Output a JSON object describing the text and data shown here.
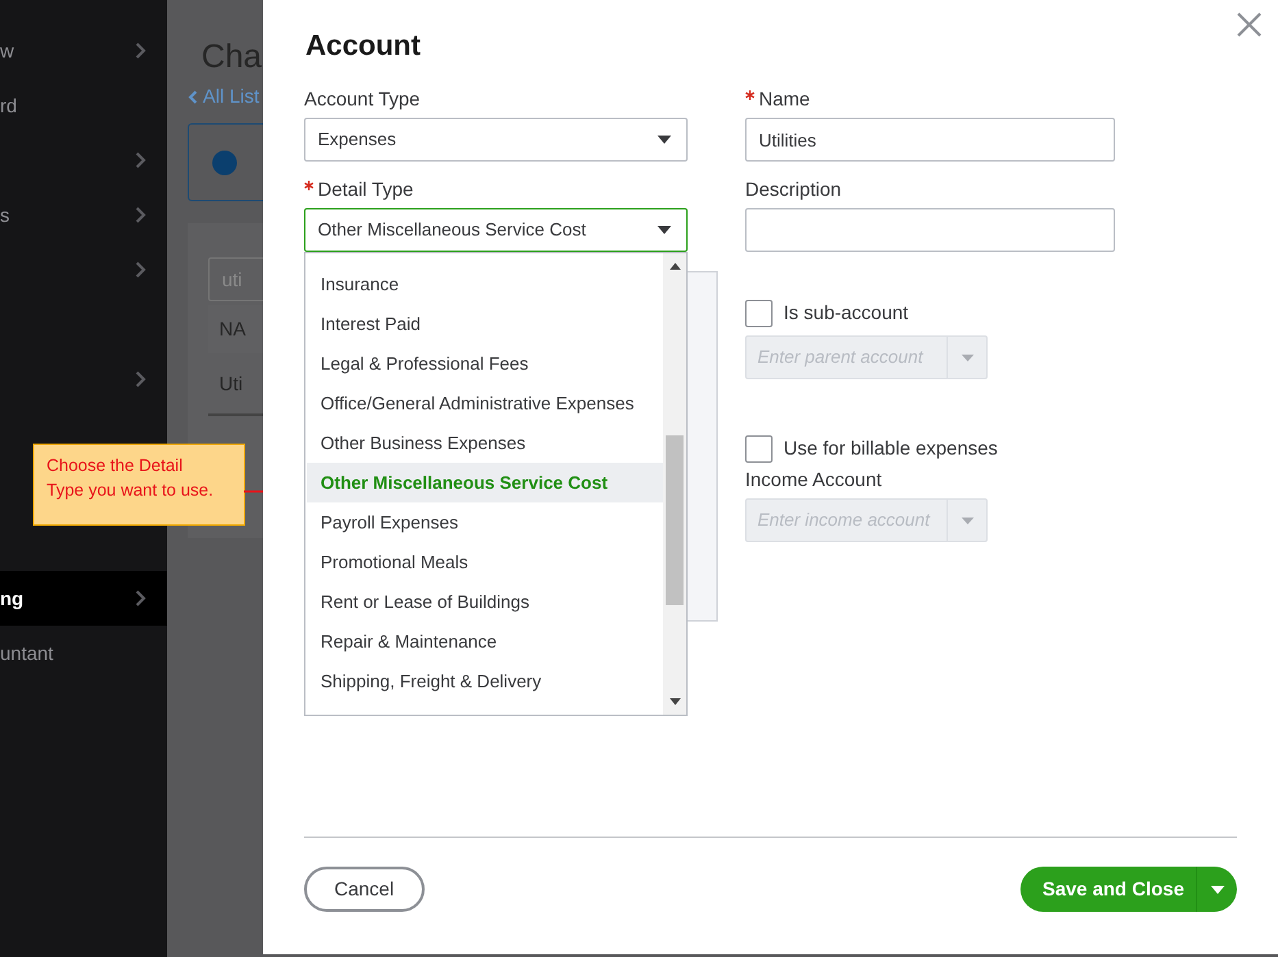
{
  "sidebar": {
    "items": [
      {
        "kind": "item",
        "label": "w",
        "arrow": true,
        "selected": false
      },
      {
        "kind": "item",
        "label": "rd",
        "arrow": false,
        "selected": false
      },
      {
        "kind": "item",
        "arrow": true,
        "selected": false
      },
      {
        "kind": "item",
        "label": "s",
        "arrow": true,
        "selected": false
      },
      {
        "kind": "item",
        "arrow": true,
        "selected": false
      },
      {
        "kind": "blank"
      },
      {
        "kind": "item",
        "arrow": true,
        "selected": false
      },
      {
        "kind": "blank"
      },
      {
        "kind": "blank"
      },
      {
        "kind": "blank"
      },
      {
        "kind": "item",
        "label": "ng",
        "arrow": true,
        "selected": true
      },
      {
        "kind": "item",
        "label": "untant",
        "arrow": false,
        "selected": false
      }
    ]
  },
  "page": {
    "title": "Cha",
    "back_link": "All List",
    "search_value": "uti",
    "column_header": "NA",
    "row_cell": "Uti"
  },
  "callout": {
    "text": "Choose the Detail Type you want to use."
  },
  "dialog": {
    "title": "Account",
    "account_type": {
      "label": "Account Type",
      "value": "Expenses"
    },
    "detail_type": {
      "label": "Detail Type",
      "required": true,
      "value": "Other Miscellaneous Service Cost",
      "expanded": true,
      "options": [
        {
          "label": "Insurance",
          "selected": false
        },
        {
          "label": "Interest Paid",
          "selected": false
        },
        {
          "label": "Legal & Professional Fees",
          "selected": false
        },
        {
          "label": "Office/General Administrative Expenses",
          "selected": false
        },
        {
          "label": "Other Business Expenses",
          "selected": false
        },
        {
          "label": "Other Miscellaneous Service Cost",
          "selected": true
        },
        {
          "label": "Payroll Expenses",
          "selected": false
        },
        {
          "label": "Promotional Meals",
          "selected": false
        },
        {
          "label": "Rent or Lease of Buildings",
          "selected": false
        },
        {
          "label": "Repair & Maintenance",
          "selected": false
        },
        {
          "label": "Shipping, Freight & Delivery",
          "selected": false
        }
      ]
    },
    "name": {
      "label": "Name",
      "required": true,
      "value": "Utilities"
    },
    "description": {
      "label": "Description"
    },
    "sub_account": {
      "label": "Is sub-account",
      "checked": false,
      "placeholder": "Enter parent account",
      "disabled": true
    },
    "billable": {
      "label": "Use for billable expenses",
      "checked": false
    },
    "income_account": {
      "label": "Income Account",
      "placeholder": "Enter income account",
      "disabled": true
    },
    "buttons": {
      "cancel": "Cancel",
      "save": "Save and Close"
    }
  }
}
